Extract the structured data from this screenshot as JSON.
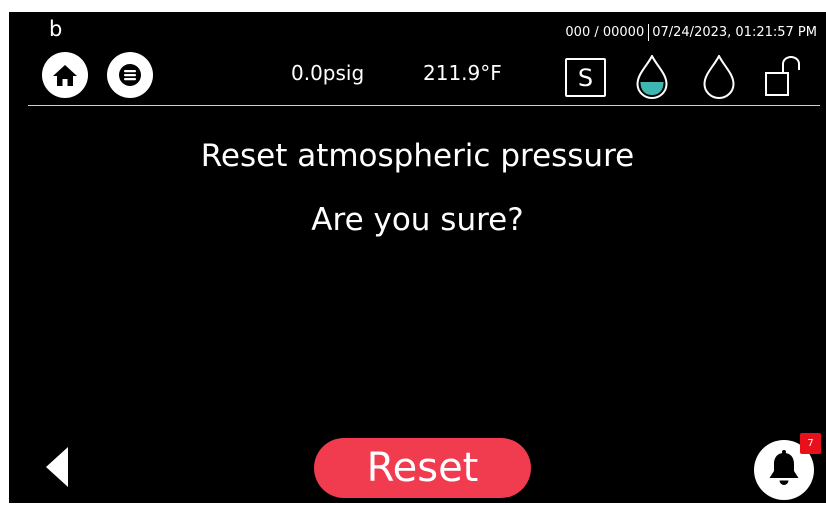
{
  "header": {
    "user_initial": "b",
    "counter": "000 / 00000",
    "datetime": "07/24/2023, 01:21:57 PM",
    "pressure": "0.0psig",
    "temperature": "211.9°F",
    "mode_badge": "S"
  },
  "dialog": {
    "title": "Reset atmospheric pressure",
    "question": "Are you sure?",
    "confirm_label": "Reset"
  },
  "notifications": {
    "count": "7"
  },
  "icons": [
    "home-icon",
    "menu-icon",
    "water-drop-filled-icon",
    "water-drop-outline-icon",
    "unlocked-padlock-icon",
    "back-arrow-icon",
    "bell-icon"
  ],
  "colors": {
    "background": "#000000",
    "reset_button": "#f13b4e",
    "water_fill": "#3fb6b2",
    "notification_badge": "#e8101a"
  }
}
